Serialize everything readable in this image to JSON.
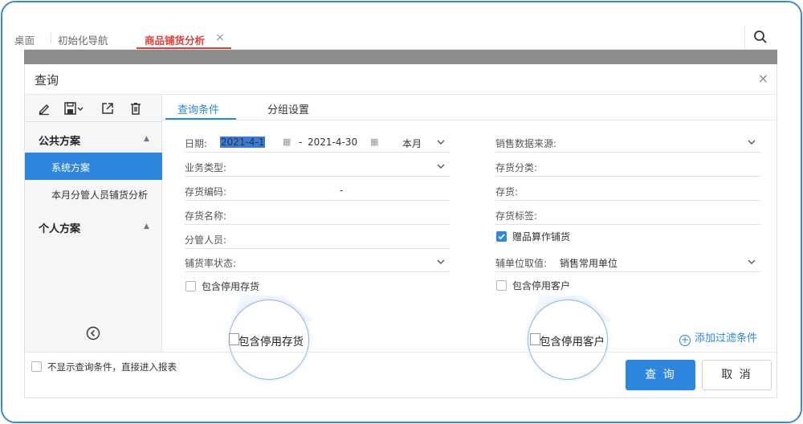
{
  "tabs": [
    {
      "label": "桌面"
    },
    {
      "label": "初始化导航"
    },
    {
      "label": "商品铺货分析"
    }
  ],
  "dialog": {
    "title": "查询",
    "confirm_label": "查 询",
    "cancel_label": "取 消"
  },
  "left_panel": {
    "public_section": "公共方案",
    "public_items": [
      "系统方案",
      "本月分管人员铺货分析"
    ],
    "personal_section": "个人方案"
  },
  "subtabs": [
    "查询条件",
    "分组设置"
  ],
  "form": {
    "date_label": "日期:",
    "date_from": "2021-4-1",
    "date_sep": "-",
    "date_to": "2021-4-30",
    "period": "本月",
    "business_type_label": "业务类型:",
    "stock_code_label": "存货编码:",
    "stock_code_sep": "-",
    "stock_name_label": "存货名称:",
    "manager_label": "分管人员:",
    "rate_status_label": "铺货率状态:",
    "include_disabled_stock": "包含停用存货",
    "sales_source_label": "销售数据来源:",
    "stock_category_label": "存货分类:",
    "stock_label": "存货:",
    "stock_tag_label": "存货标签:",
    "gift_as_distribution": "赠品算作铺货",
    "aux_unit_label": "辅单位取值:",
    "aux_unit_value": "销售常用单位",
    "include_disabled_customer": "包含停用客户",
    "add_filter": "添加过滤条件"
  },
  "footer": {
    "skip_conditions": "不显示查询条件，直接进入报表"
  },
  "colors": {
    "accent": "#2e86de",
    "active_tab": "#e0403c",
    "frame": "#3d86e0"
  }
}
